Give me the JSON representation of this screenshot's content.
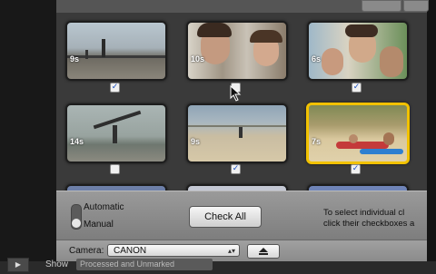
{
  "clips": [
    {
      "duration": "9s",
      "checked": true,
      "scene": "pier"
    },
    {
      "duration": "10s",
      "checked": false,
      "scene": "two-people-closeup"
    },
    {
      "duration": "6s",
      "checked": true,
      "scene": "friends-smiling"
    },
    {
      "duration": "14s",
      "checked": false,
      "scene": "surfboard-shore"
    },
    {
      "duration": "9s",
      "checked": true,
      "scene": "beach-walk"
    },
    {
      "duration": "7s",
      "checked": true,
      "scene": "kayaks-beach",
      "selected": true
    }
  ],
  "import_panel": {
    "mode_automatic": "Automatic",
    "mode_manual": "Manual",
    "check_all_label": "Check All",
    "hint_line1": "To select individual cl",
    "hint_line2": "click their checkboxes a"
  },
  "camera": {
    "label": "Camera:",
    "selected": "CANON"
  },
  "footer": {
    "show_label": "Show",
    "show_value": "Processed and Unmarked"
  },
  "colors": {
    "selection": "#f2c200",
    "sheet_bg": "#3a3a3a",
    "panel_bg": "#8c8c8c"
  }
}
